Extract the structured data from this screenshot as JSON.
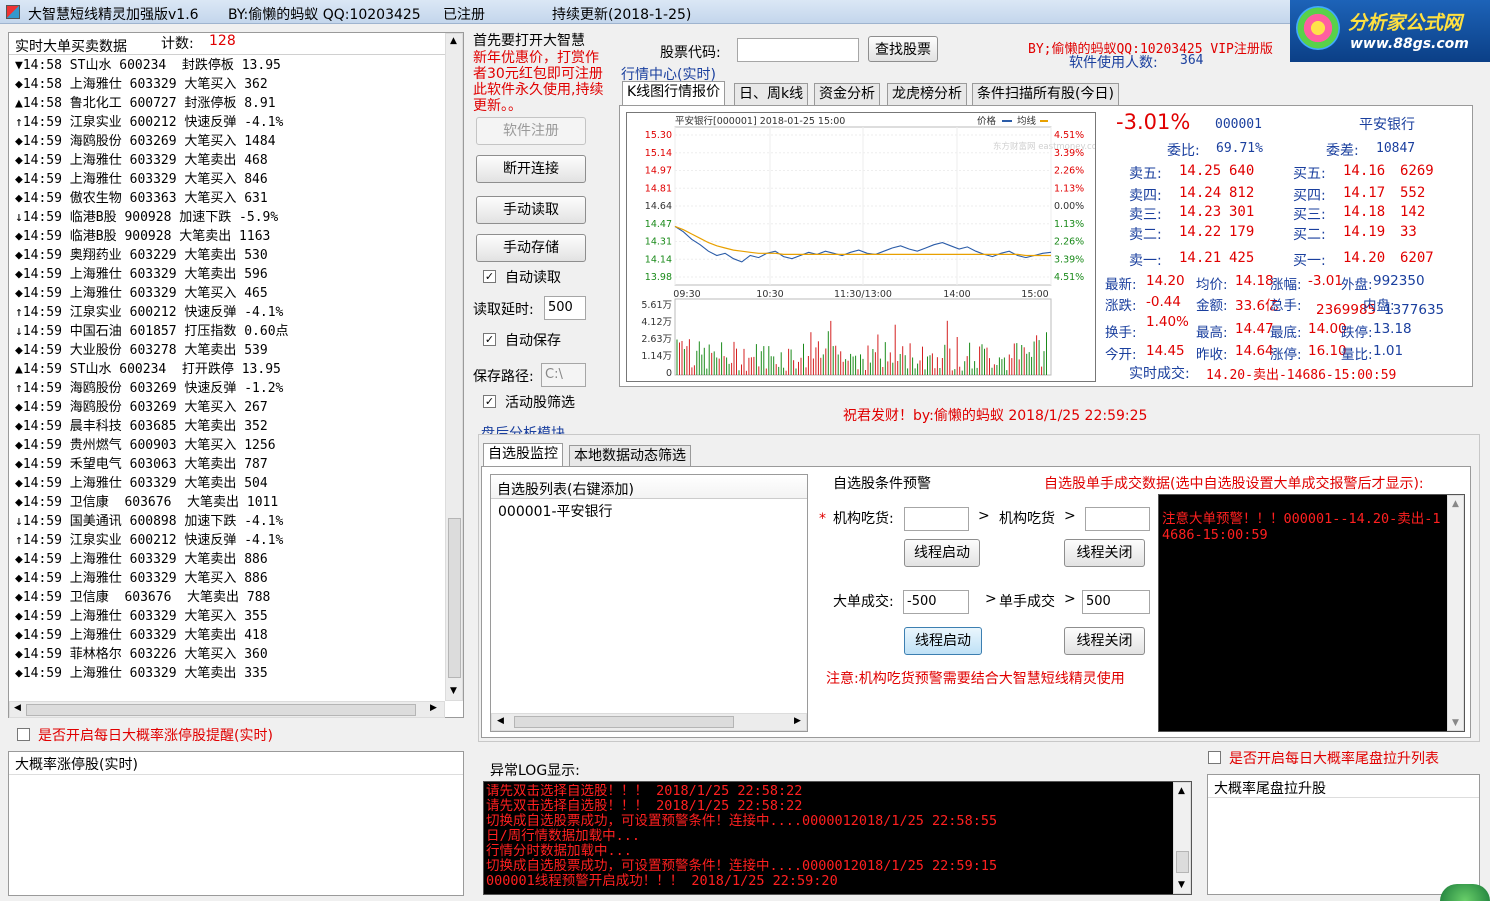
{
  "title_bar": {
    "app_title": "大智慧短线精灵加强版v1.6",
    "author": "BY:偷懒的蚂蚁 QQ:10203425",
    "reg_status": "已注册",
    "update": "持续更新(2018-1-25)",
    "logo_text": "分析家公式网",
    "logo_url": "www.88gs.com"
  },
  "feed": {
    "header": "实时大单买卖数据",
    "count_label": "计数:",
    "count": "128",
    "rows": [
      {
        "icon": "▼",
        "text": "14:58 ST山水 600234  封跌停板 13.95"
      },
      {
        "icon": "◆",
        "text": "14:58 上海雅仕 603329 大笔买入 362"
      },
      {
        "icon": "▲",
        "text": "14:58 鲁北化工 600727 封涨停板 8.91"
      },
      {
        "icon": "↑",
        "text": "14:59 江泉实业 600212 快速反弹 -4.1%"
      },
      {
        "icon": "◆",
        "text": "14:59 海鸥股份 603269 大笔买入 1484"
      },
      {
        "icon": "◆",
        "text": "14:59 上海雅仕 603329 大笔卖出 468"
      },
      {
        "icon": "◆",
        "text": "14:59 上海雅仕 603329 大笔买入 846"
      },
      {
        "icon": "◆",
        "text": "14:59 傲农生物 603363 大笔买入 631"
      },
      {
        "icon": "↓",
        "text": "14:59 临港B股 900928 加速下跌 -5.9%"
      },
      {
        "icon": "◆",
        "text": "14:59 临港B股 900928 大笔卖出 1163"
      },
      {
        "icon": "◆",
        "text": "14:59 奥翔药业 603229 大笔卖出 530"
      },
      {
        "icon": "◆",
        "text": "14:59 上海雅仕 603329 大笔卖出 596"
      },
      {
        "icon": "◆",
        "text": "14:59 上海雅仕 603329 大笔买入 465"
      },
      {
        "icon": "↑",
        "text": "14:59 江泉实业 600212 快速反弹 -4.1%"
      },
      {
        "icon": "↓",
        "text": "14:59 中国石油 601857 打压指数 0.60点"
      },
      {
        "icon": "◆",
        "text": "14:59 大业股份 603278 大笔卖出 539"
      },
      {
        "icon": "▲",
        "text": "14:59 ST山水 600234  打开跌停 13.95"
      },
      {
        "icon": "↑",
        "text": "14:59 海鸥股份 603269 快速反弹 -1.2%"
      },
      {
        "icon": "◆",
        "text": "14:59 海鸥股份 603269 大笔买入 267"
      },
      {
        "icon": "◆",
        "text": "14:59 晨丰科技 603685 大笔卖出 352"
      },
      {
        "icon": "◆",
        "text": "14:59 贵州燃气 600903 大笔买入 1256"
      },
      {
        "icon": "◆",
        "text": "14:59 禾望电气 603063 大笔卖出 787"
      },
      {
        "icon": "◆",
        "text": "14:59 上海雅仕 603329 大笔卖出 504"
      },
      {
        "icon": "◆",
        "text": "14:59 卫信康  603676  大笔卖出 1011"
      },
      {
        "icon": "↓",
        "text": "14:59 国美通讯 600898 加速下跌 -4.1%"
      },
      {
        "icon": "↑",
        "text": "14:59 江泉实业 600212 快速反弹 -4.1%"
      },
      {
        "icon": "◆",
        "text": "14:59 上海雅仕 603329 大笔卖出 886"
      },
      {
        "icon": "◆",
        "text": "14:59 上海雅仕 603329 大笔买入 886"
      },
      {
        "icon": "◆",
        "text": "14:59 卫信康  603676  大笔卖出 788"
      },
      {
        "icon": "◆",
        "text": "14:59 上海雅仕 603329 大笔买入 355"
      },
      {
        "icon": "◆",
        "text": "14:59 上海雅仕 603329 大笔卖出 418"
      },
      {
        "icon": "◆",
        "text": "14:59 菲林格尔 603226 大笔买入 360"
      },
      {
        "icon": "◆",
        "text": "14:59 上海雅仕 603329 大笔卖出 335"
      }
    ]
  },
  "limit_up": {
    "checkbox_label": "是否开启每日大概率涨停股提醒(实时)",
    "list_header": "大概率涨停股(实时)"
  },
  "controls": {
    "hint": "首先要打开大智慧",
    "promo": [
      "新年优惠价，打赏作",
      "者30元红包即可注册",
      "此软件永久使用,持续",
      "更新。。"
    ],
    "register": "软件注册",
    "disconnect": "断开连接",
    "manual_read": "手动读取",
    "manual_save": "手动存储",
    "auto_read": "自动读取",
    "read_delay_label": "读取延时:",
    "read_delay": "500",
    "auto_save": "自动保存",
    "save_path_label": "保存路径:",
    "save_path": "C:\\",
    "active_filter": "活动股筛选"
  },
  "search": {
    "label": "股票代码:",
    "value": "",
    "button": "查找股票",
    "credit": "BY;偷懒的蚂蚁QQ:10203425  VIP注册版",
    "users_label": "软件使用人数:",
    "users": "364"
  },
  "market": {
    "group_label": "行情中心(实时)",
    "tabs": [
      "K线图行情报价",
      "日、周k线",
      "资金分析",
      "龙虎榜分析",
      "条件扫描所有股(今日)"
    ]
  },
  "chart_data": {
    "type": "line",
    "title": "平安银行[000001] 2018-01-25 15:00",
    "legend": [
      "价格",
      "均线"
    ],
    "watermark": "东方财富网 eastmoney.com",
    "y_left_ticks": [
      "15.30",
      "15.14",
      "14.97",
      "14.81",
      "14.64",
      "14.47",
      "14.31",
      "14.14",
      "13.98"
    ],
    "y_right_ticks": [
      "4.51%",
      "3.39%",
      "2.26%",
      "1.13%",
      "0.00%",
      "1.13%",
      "2.26%",
      "3.39%",
      "4.51%"
    ],
    "x_ticks": [
      "09:30",
      "10:30",
      "11:30/13:00",
      "14:00",
      "15:00"
    ],
    "ylim": [
      13.98,
      15.3
    ],
    "price": [
      14.45,
      14.4,
      14.33,
      14.28,
      14.22,
      14.18,
      14.2,
      14.15,
      14.12,
      14.18,
      14.16,
      14.2,
      14.22,
      14.17,
      14.15,
      14.18,
      14.21,
      14.19,
      14.22,
      14.2,
      14.18,
      14.21,
      14.23,
      14.2,
      14.19,
      14.22,
      14.25,
      14.27,
      14.24,
      14.22,
      14.25,
      14.28,
      14.3,
      14.27,
      14.24,
      14.26,
      14.22,
      14.19,
      14.17,
      14.2,
      14.22,
      14.18,
      14.16,
      14.18,
      14.2,
      14.21
    ],
    "avg": [
      14.45,
      14.42,
      14.38,
      14.34,
      14.3,
      14.27,
      14.25,
      14.23,
      14.22,
      14.21,
      14.2,
      14.2,
      14.2,
      14.19,
      14.19,
      14.19,
      14.19,
      14.19,
      14.19,
      14.19,
      14.19,
      14.19,
      14.19,
      14.19,
      14.19,
      14.19,
      14.19,
      14.19,
      14.19,
      14.19,
      14.19,
      14.19,
      14.19,
      14.19,
      14.19,
      14.19,
      14.19,
      14.19,
      14.19,
      14.19,
      14.19,
      14.19,
      14.18,
      14.18,
      14.18,
      14.18
    ],
    "vol_ticks": [
      "5.61万",
      "4.12万",
      "2.63万",
      "1.14万",
      "0"
    ],
    "vol_max": 56100
  },
  "quote": {
    "change_pct": "-3.01%",
    "code": "000001",
    "name": "平安银行",
    "wb_label": "委比:",
    "wb": "69.71%",
    "wc_label": "委差:",
    "wc": "10847",
    "sells": [
      [
        "卖五:",
        "14.25",
        "640"
      ],
      [
        "卖四:",
        "14.24",
        "812"
      ],
      [
        "卖三:",
        "14.23",
        "301"
      ],
      [
        "卖二:",
        "14.22",
        "179"
      ],
      [
        "卖一:",
        "14.21",
        "425"
      ]
    ],
    "buys": [
      [
        "买五:",
        "14.16",
        "6269"
      ],
      [
        "买四:",
        "14.17",
        "552"
      ],
      [
        "买三:",
        "14.18",
        "142"
      ],
      [
        "买二:",
        "14.19",
        "33"
      ],
      [
        "买一:",
        "14.20",
        "6207"
      ]
    ],
    "stats": [
      [
        "最新:",
        "14.20",
        "均价:",
        "14.18",
        "涨幅:",
        "-3.01",
        "外盘:",
        "992350"
      ],
      [
        "涨跌:",
        "-0.44",
        "金额:",
        "33.6亿",
        "总手:",
        "2369985",
        "内盘:",
        "1377635"
      ],
      [
        "换手:",
        "1.40%",
        "最高:",
        "14.47",
        "最底:",
        "14.00",
        "跌停:",
        "13.18"
      ],
      [
        "今开:",
        "14.45",
        "昨收:",
        "14.64",
        "涨停:",
        "16.10",
        "量比:",
        "1.01"
      ]
    ],
    "last_trade_label": "实时成交:",
    "last_trade": "14.20-卖出-14686-15:00:59",
    "wish": "祝君发财！by:偷懒的蚂蚁 2018/1/25 22:59:25"
  },
  "post_market": {
    "group_label": "盘后分析模块",
    "tabs": [
      "自选股监控",
      "本地数据动态筛选"
    ],
    "watch_header": "自选股列表(右键添加)",
    "watch_items": [
      "000001-平安银行"
    ],
    "cond_title": "自选股条件预警",
    "star": "*",
    "inst_buy_label": "机构吃货:",
    "inst_buy_label2": "机构吃货",
    "gt": ">",
    "thread_start": "线程启动",
    "thread_stop": "线程关闭",
    "big_label": "大单成交:",
    "big_value": "-500",
    "single_label": "单手成交",
    "single_value": "500",
    "note": "注意:机构吃货预警需要结合大智慧短线精灵使用",
    "alert_title": "自选股单手成交数据(选中自选股设置大单成交报警后才显示):",
    "alert_text": "注意大单预警！！！000001--14.20-卖出-14686-15:00:59"
  },
  "log": {
    "label": "异常LOG显示:",
    "lines": [
      "请先双击选择自选股！！！  2018/1/25 22:58:22",
      "请先双击选择自选股！！！  2018/1/25 22:58:22",
      "切换成自选股票成功，可设置预警条件！连接中....0000012018/1/25 22:58:55",
      "日/周行情数据加载中...",
      "行情分时数据加载中...",
      "切换成自选股票成功，可设置预警条件！连接中....0000012018/1/25 22:59:15",
      "000001线程预警开启成功！！！ 2018/1/25 22:59:20"
    ]
  },
  "tail": {
    "checkbox_label": "是否开启每日大概率尾盘拉升列表",
    "list_header": "大概率尾盘拉升股"
  },
  "colors": {
    "red": "#e00000",
    "price_line": "#2b5ca8",
    "avg_line": "#e8a000",
    "vol_up": "#d42020",
    "vol_down": "#1a8a1a"
  }
}
